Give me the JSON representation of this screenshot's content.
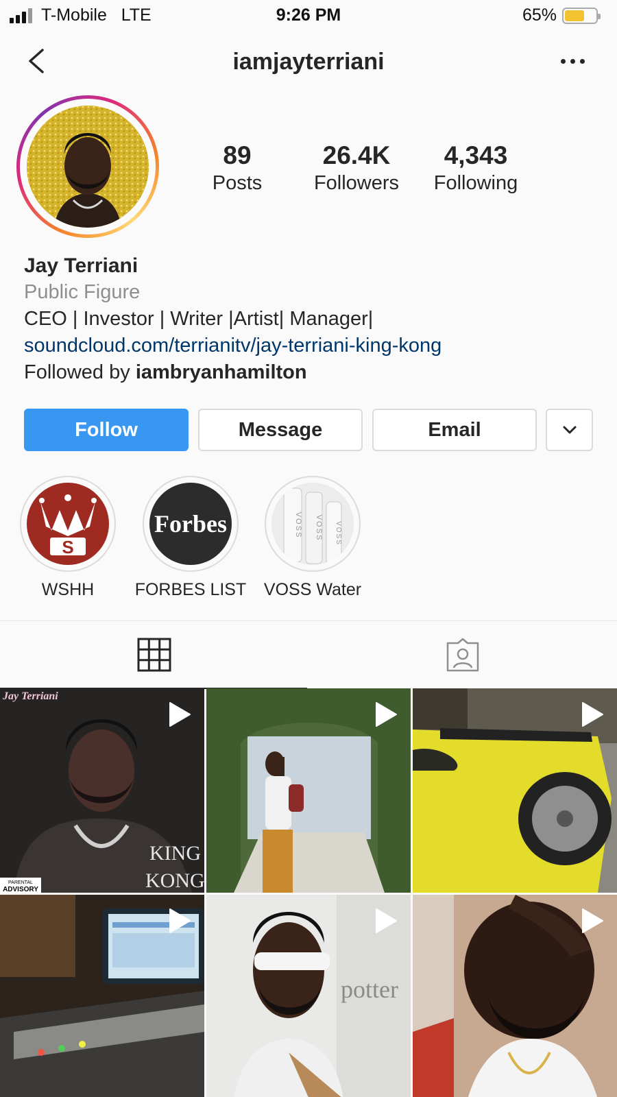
{
  "status_bar": {
    "carrier": "T-Mobile",
    "network": "LTE",
    "time": "9:26 PM",
    "battery_percent": "65%",
    "battery_level": 0.65
  },
  "header": {
    "username": "iamjayterriani",
    "back_icon": "chevron-left-icon",
    "more_icon": "more-horizontal-icon"
  },
  "profile": {
    "stats": [
      {
        "value": "89",
        "label": "Posts"
      },
      {
        "value": "26.4K",
        "label": "Followers"
      },
      {
        "value": "4,343",
        "label": "Following"
      }
    ],
    "name": "Jay Terriani",
    "category": "Public Figure",
    "bio": "CEO | Investor | Writer |Artist| Manager|",
    "link": "soundcloud.com/terrianitv/jay-terriani-king-kong",
    "followed_by_prefix": "Followed by ",
    "followed_by_user": "iambryanhamilton"
  },
  "actions": {
    "follow": "Follow",
    "message": "Message",
    "email": "Email",
    "more_icon": "chevron-down-icon"
  },
  "highlights": [
    {
      "label": "WSHH",
      "logo_text": "S"
    },
    {
      "label": "FORBES LIST",
      "logo_text": "Forbes"
    },
    {
      "label": "VOSS Water",
      "logo_text": "VOSS"
    }
  ],
  "tabs": [
    {
      "icon": "grid-icon",
      "active": true
    },
    {
      "icon": "tagged-icon",
      "active": false
    }
  ],
  "posts": [
    {
      "type": "video",
      "overlay_text": [
        "Jay Terriani",
        "KING",
        "KONG",
        "PARENTAL",
        "ADVISORY"
      ]
    },
    {
      "type": "video"
    },
    {
      "type": "video"
    },
    {
      "type": "video"
    },
    {
      "type": "video",
      "overlay_text": [
        "potter"
      ]
    },
    {
      "type": "video"
    }
  ],
  "colors": {
    "follow_blue": "#3897f0",
    "link_blue": "#00376b",
    "text": "#262626",
    "secondary": "#8e8e8e"
  }
}
